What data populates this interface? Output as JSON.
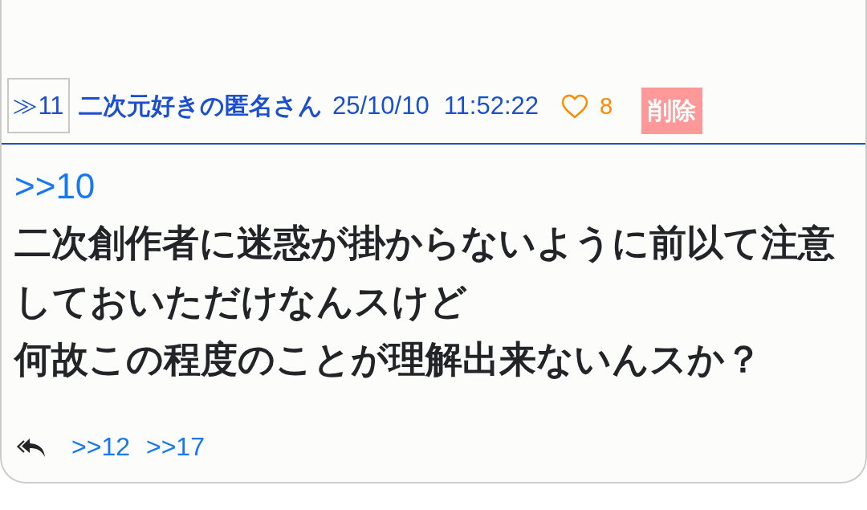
{
  "post": {
    "number": "≫11",
    "author": "二次元好きの匿名さん",
    "date": "25/10/10",
    "time": "11:52:22",
    "like": {
      "liked": false,
      "count": "8"
    },
    "delete_label": "削除",
    "anchor": ">>10",
    "body": [
      "二次創作者に迷惑が掛からないように前以て注意しておいただけなんスけど",
      "何故この程度のことが理解出来ないんスか？"
    ],
    "replies": [
      ">>12",
      ">>17"
    ]
  }
}
